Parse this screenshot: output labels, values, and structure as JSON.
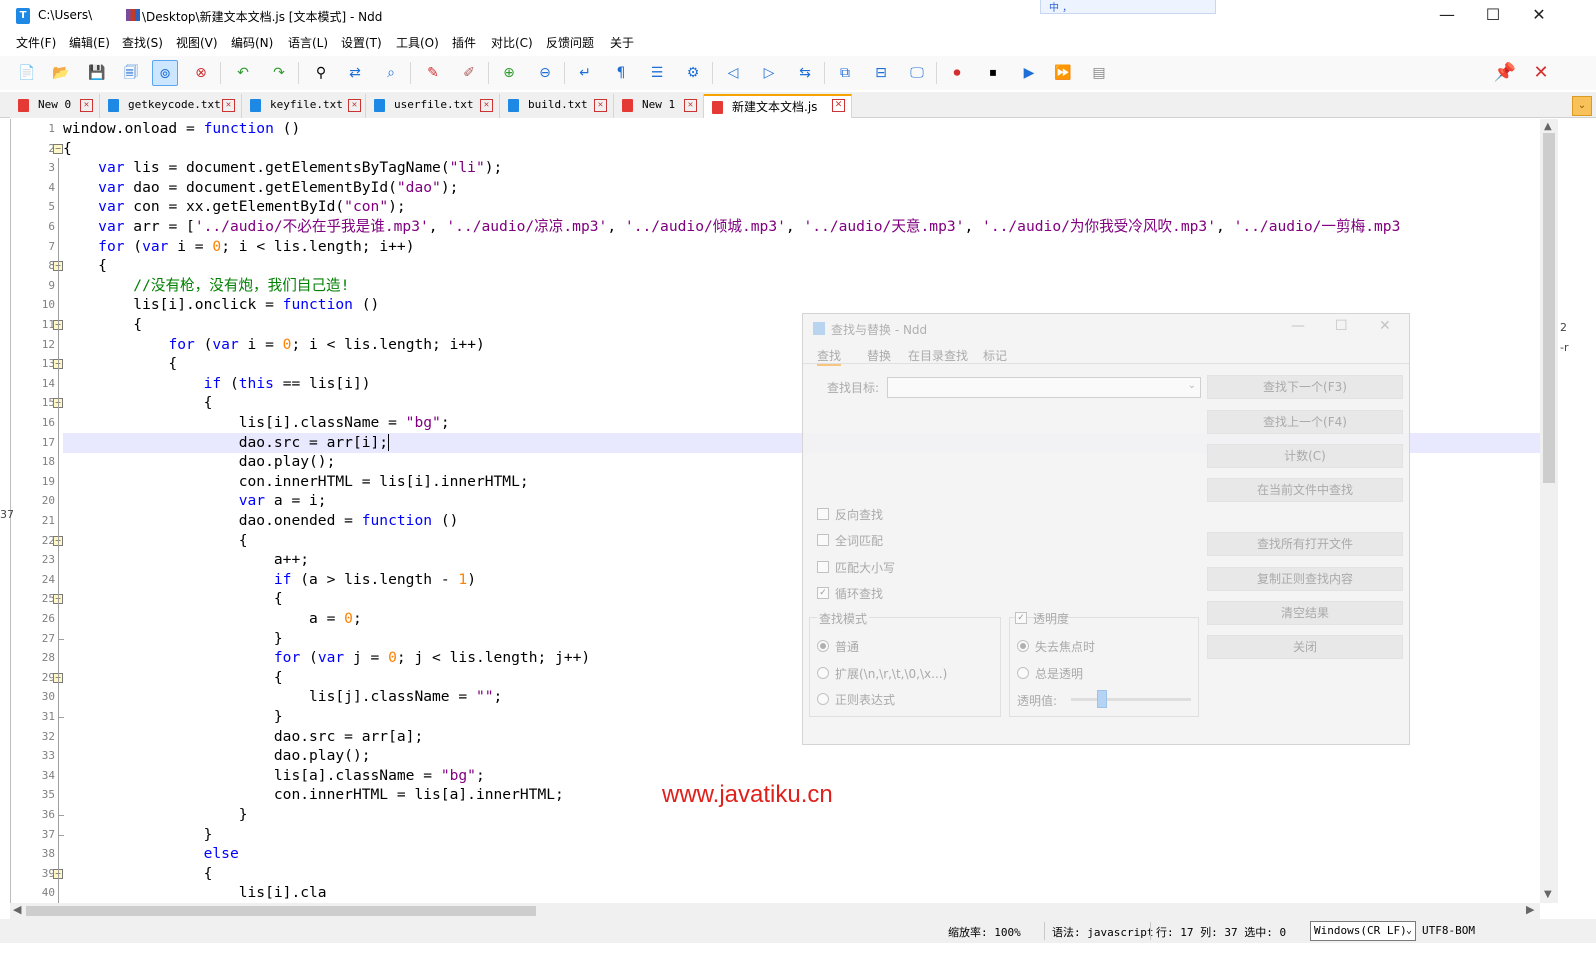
{
  "window": {
    "title_left": "C:\\Users\\",
    "title_mid": "\\Desktop\\新建文本文档.js [文本模式] - Ndd",
    "min_glyph": "—",
    "max_glyph": "☐",
    "close_glyph": "✕",
    "ime": "中 ，"
  },
  "menu": [
    "文件(F)",
    "编辑(E)",
    "查找(S)",
    "视图(V)",
    "编码(N)",
    "语言(L)",
    "设置(T)",
    "工具(O)",
    "插件",
    "对比(C)",
    "反馈问题",
    "关于"
  ],
  "tabs": [
    {
      "label": "New 0",
      "color": "red"
    },
    {
      "label": "getkeycode.txt",
      "color": "blue"
    },
    {
      "label": "keyfile.txt",
      "color": "blue"
    },
    {
      "label": "userfile.txt",
      "color": "blue"
    },
    {
      "label": "build.txt",
      "color": "blue"
    },
    {
      "label": "New 1",
      "color": "red"
    },
    {
      "label": "新建文本文档.js",
      "color": "red",
      "active": true
    }
  ],
  "editor": {
    "current_line": 17,
    "lines": [
      {
        "n": "1",
        "fold": "",
        "html": "window.onload = <span class='kw'>function</span> ()"
      },
      {
        "n": "2",
        "fold": "box",
        "html": "{"
      },
      {
        "n": "3",
        "fold": "",
        "html": "    <span class='kw'>var</span> lis = document.getElementsByTagName(<span class='str'>\"li\"</span>);"
      },
      {
        "n": "4",
        "fold": "",
        "html": "    <span class='kw'>var</span> dao = document.getElementById(<span class='str'>\"dao\"</span>);"
      },
      {
        "n": "5",
        "fold": "",
        "html": "    <span class='kw'>var</span> con = xx.getElementById(<span class='str'>\"con\"</span>);"
      },
      {
        "n": "6",
        "fold": "",
        "html": "    <span class='kw'>var</span> arr = [<span class='str'>'../audio/不必在乎我是谁.mp3'</span>, <span class='str'>'../audio/凉凉.mp3'</span>, <span class='str'>'../audio/倾城.mp3'</span>, <span class='str'>'../audio/天意.mp3'</span>, <span class='str'>'../audio/为你我受冷风吹.mp3'</span>, <span class='str'>'../audio/一剪梅.mp3</span>"
      },
      {
        "n": "7",
        "fold": "",
        "html": "    <span class='kw'>for</span> (<span class='kw'>var</span> i = <span class='num'>0</span>; i &lt; lis.length; i++)"
      },
      {
        "n": "8",
        "fold": "box",
        "html": "    {"
      },
      {
        "n": "9",
        "fold": "",
        "html": "        <span class='cmt'>//没有枪，没有炮，我们自己造!</span>"
      },
      {
        "n": "10",
        "fold": "",
        "html": "        lis[i].onclick = <span class='kw'>function</span> ()"
      },
      {
        "n": "11",
        "fold": "box",
        "html": "        {"
      },
      {
        "n": "12",
        "fold": "",
        "html": "            <span class='kw'>for</span> (<span class='kw'>var</span> i = <span class='num'>0</span>; i &lt; lis.length; i++)"
      },
      {
        "n": "13",
        "fold": "box",
        "html": "            {"
      },
      {
        "n": "14",
        "fold": "",
        "html": "                <span class='kw'>if</span> (<span class='kw'>this</span> == lis[i])"
      },
      {
        "n": "15",
        "fold": "box",
        "html": "                {"
      },
      {
        "n": "16",
        "fold": "",
        "html": "                    lis[i].className = <span class='str'>\"bg\"</span>;"
      },
      {
        "n": "17",
        "fold": "",
        "html": "                    dao.src = arr[i];<span class='caret'></span>"
      },
      {
        "n": "18",
        "fold": "",
        "html": "                    dao.play();"
      },
      {
        "n": "19",
        "fold": "",
        "html": "                    con.innerHTML = lis[i].innerHTML;"
      },
      {
        "n": "20",
        "fold": "",
        "html": "                    <span class='kw'>var</span> a = i;"
      },
      {
        "n": "21",
        "fold": "",
        "html": "                    dao.onended = <span class='kw'>function</span> ()"
      },
      {
        "n": "22",
        "fold": "box",
        "html": "                    {"
      },
      {
        "n": "23",
        "fold": "",
        "html": "                        a++;"
      },
      {
        "n": "24",
        "fold": "",
        "html": "                        <span class='kw'>if</span> (a &gt; lis.length - <span class='num'>1</span>)"
      },
      {
        "n": "25",
        "fold": "box",
        "html": "                        {"
      },
      {
        "n": "26",
        "fold": "",
        "html": "                            a = <span class='num'>0</span>;"
      },
      {
        "n": "27",
        "fold": "end",
        "html": "                        }"
      },
      {
        "n": "28",
        "fold": "",
        "html": "                        <span class='kw'>for</span> (<span class='kw'>var</span> j = <span class='num'>0</span>; j &lt; lis.length; j++)"
      },
      {
        "n": "29",
        "fold": "box",
        "html": "                        {"
      },
      {
        "n": "30",
        "fold": "",
        "html": "                            lis[j].className = <span class='str'>\"\"</span>;"
      },
      {
        "n": "31",
        "fold": "end",
        "html": "                        }"
      },
      {
        "n": "32",
        "fold": "",
        "html": "                        dao.src = arr[a];"
      },
      {
        "n": "33",
        "fold": "",
        "html": "                        dao.play();"
      },
      {
        "n": "34",
        "fold": "",
        "html": "                        lis[a].className = <span class='str'>\"bg\"</span>;"
      },
      {
        "n": "35",
        "fold": "",
        "html": "                        con.innerHTML = lis[a].innerHTML;"
      },
      {
        "n": "36",
        "fold": "end",
        "html": "                    }"
      },
      {
        "n": "37",
        "fold": "end",
        "html": "                }"
      },
      {
        "n": "38",
        "fold": "",
        "html": "                <span class='kw'>else</span>"
      },
      {
        "n": "39",
        "fold": "box",
        "html": "                {"
      },
      {
        "n": "40",
        "fold": "",
        "html": "                    lis[i].cla"
      }
    ]
  },
  "watermark": "www.javatiku.cn",
  "status": {
    "zoom": "缩放率: 100%",
    "syntax": "语法: javascript",
    "position": "行: 17 列: 37 选中: 0",
    "eol": "Windows(CR LF)",
    "encoding": "UTF8-BOM"
  },
  "find_dialog": {
    "title": "查找与替换 - Ndd",
    "tabs": [
      "查找",
      "替换",
      "在目录查找",
      "标记"
    ],
    "target_label": "查找目标:",
    "buttons": [
      "查找下一个(F3)",
      "查找上一个(F4)",
      "计数(C)",
      "在当前文件中查找",
      "查找所有打开文件",
      "复制正则查找内容",
      "清空结果",
      "关闭"
    ],
    "checkboxes": [
      {
        "label": "反向查找",
        "checked": false
      },
      {
        "label": "全词匹配",
        "checked": false
      },
      {
        "label": "匹配大小写",
        "checked": false
      },
      {
        "label": "循环查找",
        "checked": true
      }
    ],
    "mode_label": "查找模式",
    "modes": [
      {
        "label": "普通",
        "checked": true
      },
      {
        "label": "扩展(\\n,\\r,\\t,\\0,\\x...)",
        "checked": false
      },
      {
        "label": "正则表达式",
        "checked": false
      }
    ],
    "transparency_label": "透明度",
    "transparency_checked": true,
    "transparency_opts": [
      {
        "label": "失去焦点时",
        "checked": true
      },
      {
        "label": "总是透明",
        "checked": false
      }
    ],
    "opacity_label": "透明值:"
  },
  "peek": [
    "2",
    "-r",
    "37"
  ]
}
